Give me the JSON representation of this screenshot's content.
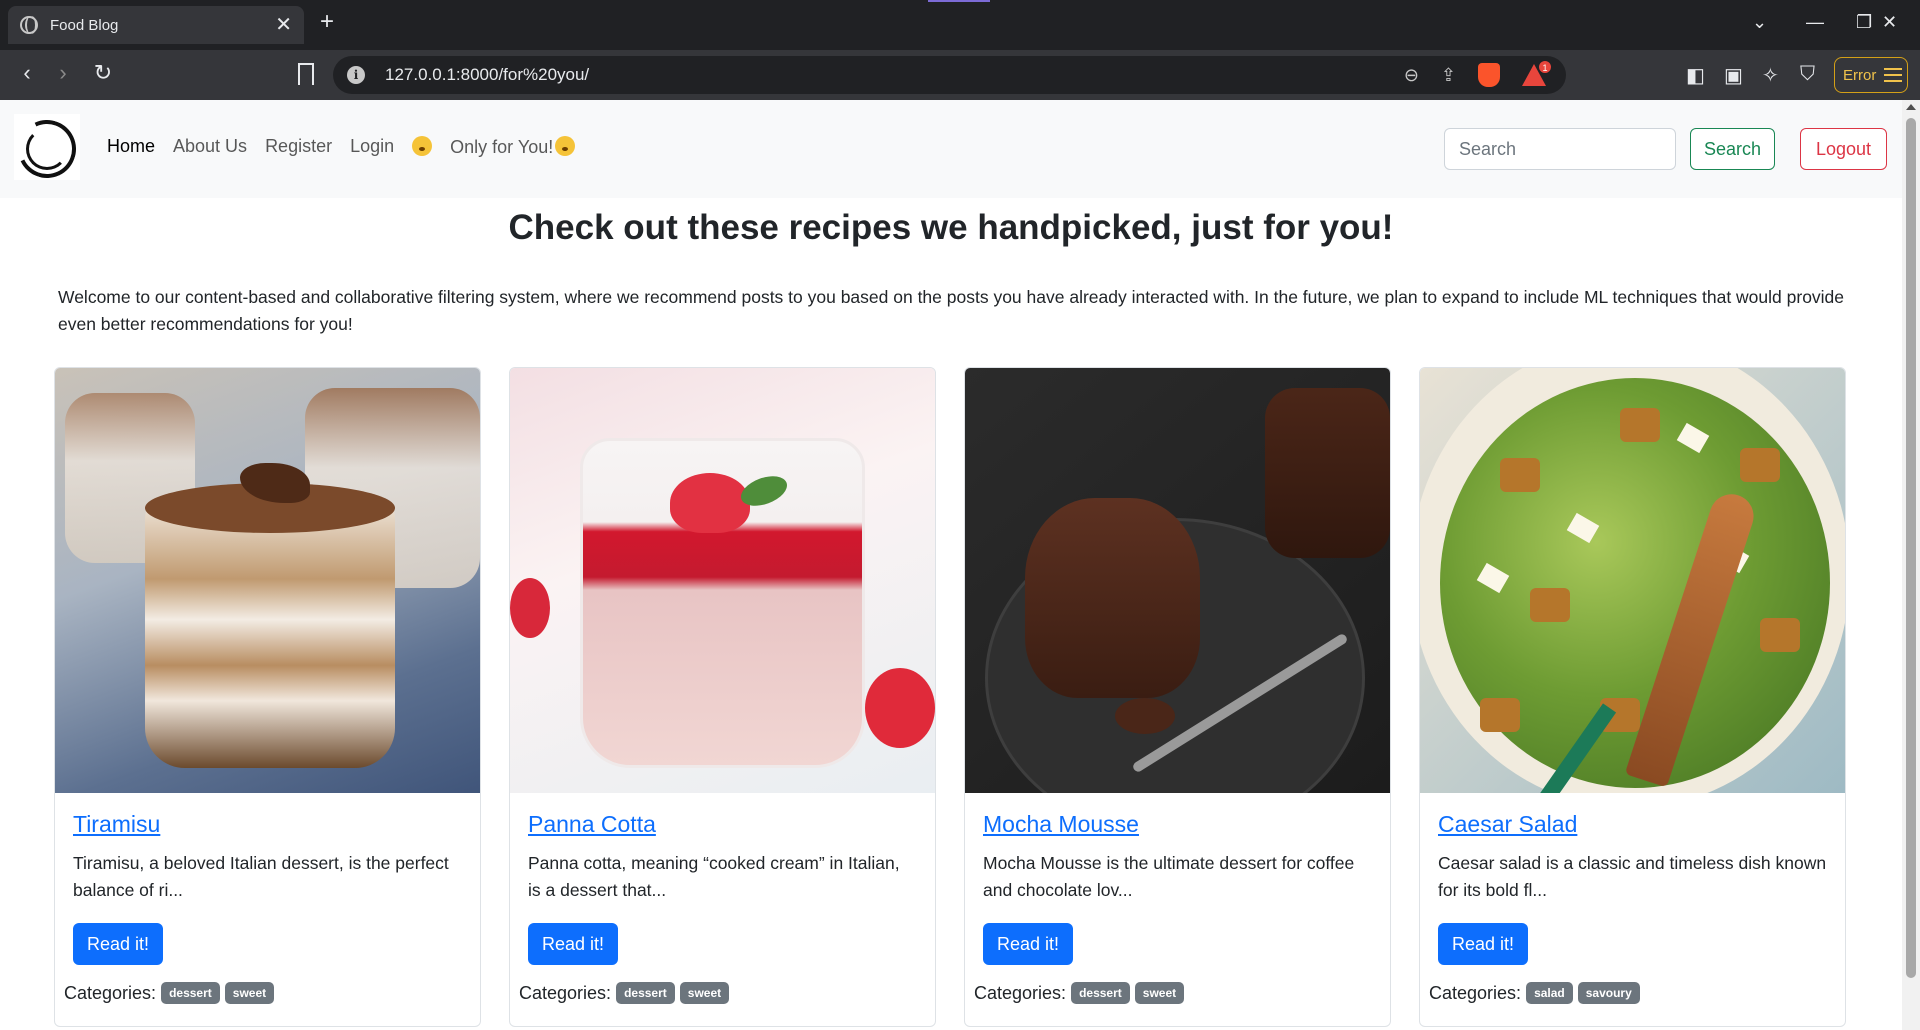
{
  "browser": {
    "tab_title": "Food Blog",
    "tab_close": "✕",
    "new_tab": "+",
    "url": "127.0.0.1:8000/for%20you/",
    "error_label": "Error",
    "notification_count": "1"
  },
  "navbar": {
    "links": {
      "home": "Home",
      "about": "About Us",
      "register": "Register",
      "login": "Login",
      "for_you": "Only for You!"
    },
    "search_placeholder": "Search",
    "search_button": "Search",
    "logout_button": "Logout"
  },
  "main": {
    "heading": "Check out these recipes we handpicked, just for you!",
    "intro": "Welcome to our content-based and collaborative filtering system, where we recommend posts to you based on the posts you have already interacted with. In the future, we plan to expand to include ML techniques that would provide even better recommendations for you!",
    "categories_label": "Categories:",
    "read_button": "Read it!",
    "cards": [
      {
        "title": "Tiramisu",
        "excerpt": "Tiramisu, a beloved Italian dessert, is the perfect balance of ri...",
        "categories": [
          "dessert",
          "sweet"
        ]
      },
      {
        "title": "Panna Cotta",
        "excerpt": "Panna cotta, meaning “cooked cream” in Italian, is a dessert that...",
        "categories": [
          "dessert",
          "sweet"
        ]
      },
      {
        "title": "Mocha Mousse",
        "excerpt": "Mocha Mousse is the ultimate dessert for coffee and chocolate lov...",
        "categories": [
          "dessert",
          "sweet"
        ]
      },
      {
        "title": "Caesar Salad",
        "excerpt": "Caesar salad is a classic and timeless dish known for its bold fl...",
        "categories": [
          "salad",
          "savoury"
        ]
      }
    ]
  },
  "colors": {
    "primary": "#0d6efd",
    "success": "#198754",
    "danger": "#dc3545",
    "badge": "#6c757d"
  }
}
